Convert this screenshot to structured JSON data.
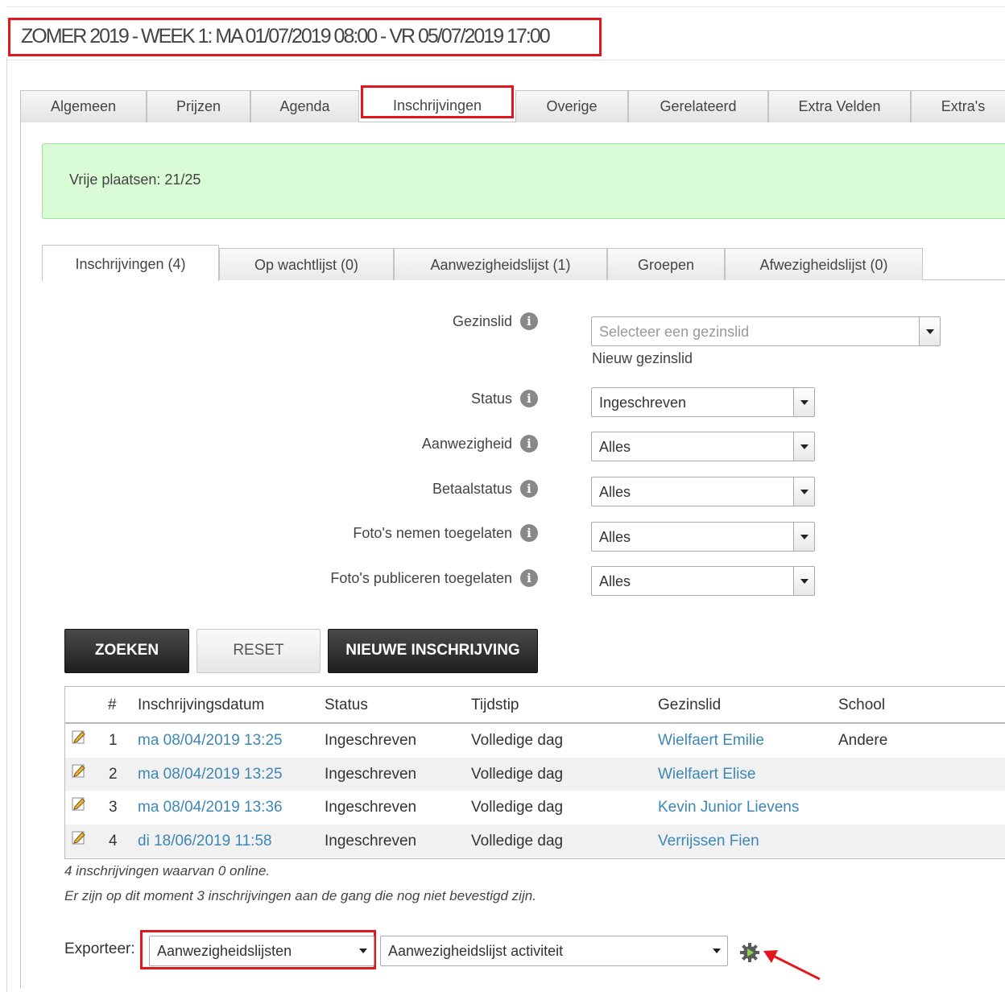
{
  "page": {
    "title": "ZOMER 2019 - WEEK 1: MA 01/07/2019 08:00 - VR 05/07/2019 17:00"
  },
  "main_tabs": [
    {
      "label": "Algemeen"
    },
    {
      "label": "Prijzen"
    },
    {
      "label": "Agenda"
    },
    {
      "label": "Inschrijvingen",
      "active": true
    },
    {
      "label": "Overige"
    },
    {
      "label": "Gerelateerd"
    },
    {
      "label": "Extra Velden"
    },
    {
      "label": "Extra's"
    }
  ],
  "notice": {
    "text": "Vrije plaatsen: 21/25"
  },
  "sub_tabs": [
    {
      "label": "Inschrijvingen (4)",
      "active": true
    },
    {
      "label": "Op wachtlijst (0)"
    },
    {
      "label": "Aanwezigheidslijst (1)"
    },
    {
      "label": "Groepen"
    },
    {
      "label": "Afwezigheidslijst (0)"
    }
  ],
  "filters": {
    "gezinslid": {
      "label": "Gezinslid",
      "placeholder": "Selecteer een gezinslid",
      "link": "Nieuw gezinslid"
    },
    "status": {
      "label": "Status",
      "value": "Ingeschreven"
    },
    "aanwezigheid": {
      "label": "Aanwezigheid",
      "value": "Alles"
    },
    "betaalstatus": {
      "label": "Betaalstatus",
      "value": "Alles"
    },
    "fotos_nemen": {
      "label": "Foto's nemen toegelaten",
      "value": "Alles"
    },
    "fotos_publiceren": {
      "label": "Foto's publiceren toegelaten",
      "value": "Alles"
    }
  },
  "buttons": {
    "search": "ZOEKEN",
    "reset": "RESET",
    "new": "NIEUWE INSCHRIJVING"
  },
  "table": {
    "headers": [
      "#",
      "Inschrijvingsdatum",
      "Status",
      "Tijdstip",
      "Gezinslid",
      "School"
    ],
    "rows": [
      {
        "num": "1",
        "date": "ma 08/04/2019 13:25",
        "status": "Ingeschreven",
        "time": "Volledige dag",
        "member": "Wielfaert Emilie",
        "school": "Andere"
      },
      {
        "num": "2",
        "date": "ma 08/04/2019 13:25",
        "status": "Ingeschreven",
        "time": "Volledige dag",
        "member": "Wielfaert Elise",
        "school": ""
      },
      {
        "num": "3",
        "date": "ma 08/04/2019 13:36",
        "status": "Ingeschreven",
        "time": "Volledige dag",
        "member": "Kevin Junior Lievens",
        "school": ""
      },
      {
        "num": "4",
        "date": "di 18/06/2019 11:58",
        "status": "Ingeschreven",
        "time": "Volledige dag",
        "member": "Verrijssen Fien",
        "school": ""
      }
    ]
  },
  "notes": {
    "count": "4 inschrijvingen waarvan 0 online.",
    "pending": "Er zijn op dit moment 3 inschrijvingen aan de gang die nog niet bevestigd zijn."
  },
  "export": {
    "label": "Exporteer:",
    "type": "Aanwezigheidslijsten",
    "template": "Aanwezigheidslijst activiteit"
  },
  "colors": {
    "highlight": "#e2161d",
    "link": "#3d87b7",
    "notice_bg": "#d9fbd6"
  }
}
